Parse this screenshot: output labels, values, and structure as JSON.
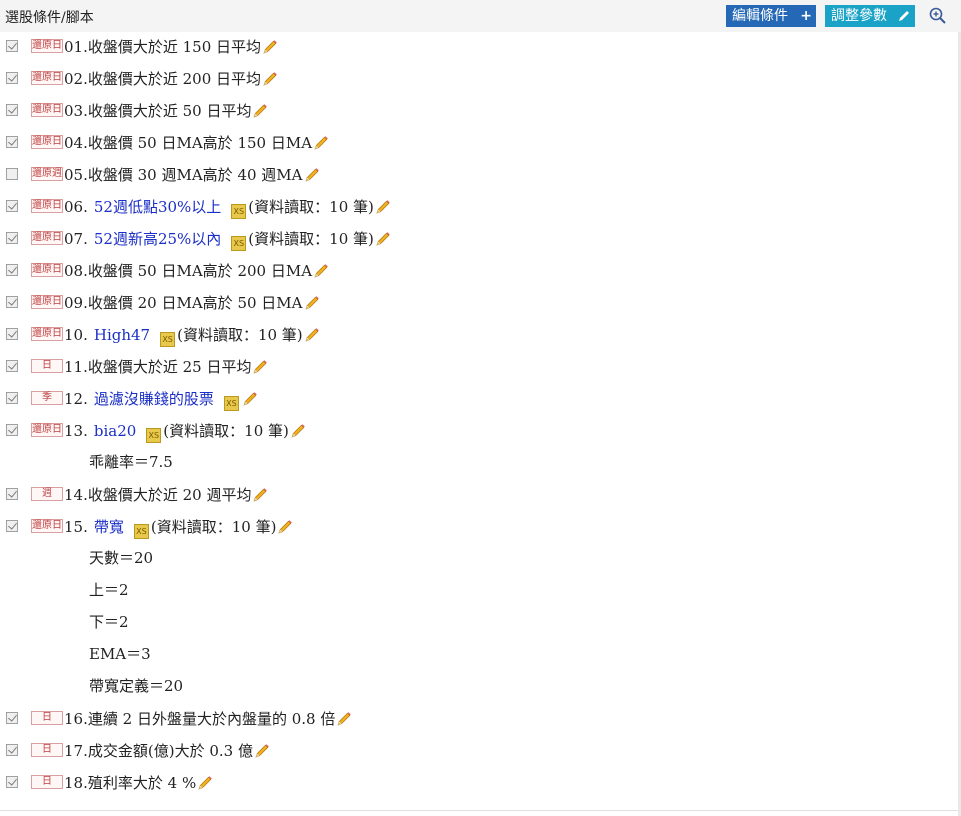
{
  "header": {
    "title": "選股條件/腳本",
    "edit_button": "編輯條件",
    "edit_glyph": "+",
    "params_button": "調整參數"
  },
  "rows": [
    {
      "checked": true,
      "badge": "還原日",
      "num": "01.",
      "text": "收盤價大於近 150 日平均",
      "link": "",
      "xs": false,
      "extra": ""
    },
    {
      "checked": true,
      "badge": "還原日",
      "num": "02.",
      "text": "收盤價大於近 200 日平均",
      "link": "",
      "xs": false,
      "extra": ""
    },
    {
      "checked": true,
      "badge": "還原日",
      "num": "03.",
      "text": "收盤價大於近 50 日平均",
      "link": "",
      "xs": false,
      "extra": ""
    },
    {
      "checked": true,
      "badge": "還原日",
      "num": "04.",
      "text": "收盤價 50 日MA高於 150 日MA",
      "link": "",
      "xs": false,
      "extra": ""
    },
    {
      "checked": false,
      "badge": "還原週",
      "num": "05.",
      "text": "收盤價 30 週MA高於 40 週MA",
      "link": "",
      "xs": false,
      "extra": ""
    },
    {
      "checked": true,
      "badge": "還原日",
      "num": "06.",
      "text": "",
      "link": "52週低點30%以上",
      "xs": true,
      "extra": "(資料讀取：10 筆)"
    },
    {
      "checked": true,
      "badge": "還原日",
      "num": "07.",
      "text": "",
      "link": "52週新高25%以內",
      "xs": true,
      "extra": "(資料讀取：10 筆)"
    },
    {
      "checked": true,
      "badge": "還原日",
      "num": "08.",
      "text": "收盤價 50 日MA高於 200 日MA",
      "link": "",
      "xs": false,
      "extra": ""
    },
    {
      "checked": true,
      "badge": "還原日",
      "num": "09.",
      "text": "收盤價 20 日MA高於 50 日MA",
      "link": "",
      "xs": false,
      "extra": ""
    },
    {
      "checked": true,
      "badge": "還原日",
      "num": "10.",
      "text": "",
      "link": "High47",
      "xs": true,
      "extra": "(資料讀取：10 筆)"
    },
    {
      "checked": true,
      "badge": "日",
      "num": "11.",
      "text": "收盤價大於近 25 日平均",
      "link": "",
      "xs": false,
      "extra": ""
    },
    {
      "checked": true,
      "badge": "季",
      "num": "12.",
      "text": "",
      "link": "過濾沒賺錢的股票",
      "xs": true,
      "extra": ""
    },
    {
      "checked": true,
      "badge": "還原日",
      "num": "13.",
      "text": "",
      "link": "bia20",
      "xs": true,
      "extra": "(資料讀取：10 筆)"
    },
    {
      "checked": true,
      "badge": "週",
      "num": "14.",
      "text": "收盤價大於近 20 週平均",
      "link": "",
      "xs": false,
      "extra": ""
    },
    {
      "checked": true,
      "badge": "還原日",
      "num": "15.",
      "text": "",
      "link": "帶寬",
      "xs": true,
      "extra": "(資料讀取：10 筆)"
    },
    {
      "checked": true,
      "badge": "日",
      "num": "16.",
      "text": "連續 2 日外盤量大於內盤量的 0.8 倍",
      "link": "",
      "xs": false,
      "extra": ""
    },
    {
      "checked": true,
      "badge": "日",
      "num": "17.",
      "text": "成交金額(億)大於 0.3 億",
      "link": "",
      "xs": false,
      "extra": ""
    },
    {
      "checked": true,
      "badge": "日",
      "num": "18.",
      "text": "殖利率大於 4 %",
      "link": "",
      "xs": false,
      "extra": ""
    }
  ],
  "params_13": [
    "乖離率＝7.5"
  ],
  "params_15": [
    "天數＝20",
    "上＝2",
    "下＝2",
    "EMA＝3",
    "帶寬定義＝20"
  ],
  "xs_label": "XS",
  "colors": {
    "edit_button": "#2568b5",
    "params_button": "#1aa3c6",
    "link": "#1a2ec8",
    "badge_border": "#d8a0a0"
  }
}
